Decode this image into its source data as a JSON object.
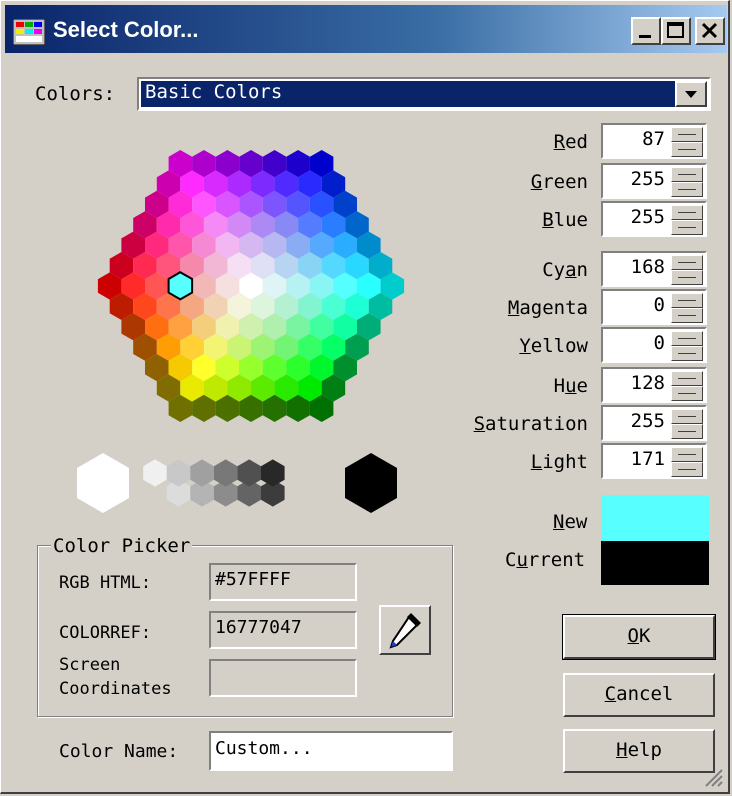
{
  "window": {
    "title": "Select Color..."
  },
  "colors_combo": {
    "label": "Colors:",
    "value": "Basic Colors"
  },
  "fields": [
    {
      "label": "Red",
      "value": "87"
    },
    {
      "label": "Green",
      "value": "255"
    },
    {
      "label": "Blue",
      "value": "255"
    },
    {
      "label": "Cyan",
      "value": "168"
    },
    {
      "label": "Magenta",
      "value": "0"
    },
    {
      "label": "Yellow",
      "value": "0"
    },
    {
      "label": "Hue",
      "value": "128"
    },
    {
      "label": "Saturation",
      "value": "255"
    },
    {
      "label": "Light",
      "value": "171"
    }
  ],
  "preview": {
    "new_label": "New",
    "current_label": "Current",
    "new_color": "#57ffff",
    "current_color": "#000000"
  },
  "color_picker": {
    "group_label": "Color Picker",
    "rgb_html_label": "RGB HTML:",
    "rgb_html_value": "#57FFFF",
    "colorref_label": "COLORREF:",
    "colorref_value": "16777047",
    "screen_coords_label_1": "Screen",
    "screen_coords_label_2": "Coordinates",
    "screen_coords_value": ""
  },
  "color_name": {
    "label": "Color Name:",
    "value": "Custom..."
  },
  "buttons": {
    "ok": "OK",
    "cancel": "Cancel",
    "help": "Help"
  },
  "gray_swatches": [
    "#ffffff",
    "#f0f0f0",
    "#dcdcdc",
    "#c8c8c8",
    "#b4b4b4",
    "#a0a0a0",
    "#8c8c8c",
    "#787878",
    "#646464",
    "#505050",
    "#3c3c3c",
    "#282828",
    "#000000"
  ],
  "selected_hex_color": "#57ffff"
}
